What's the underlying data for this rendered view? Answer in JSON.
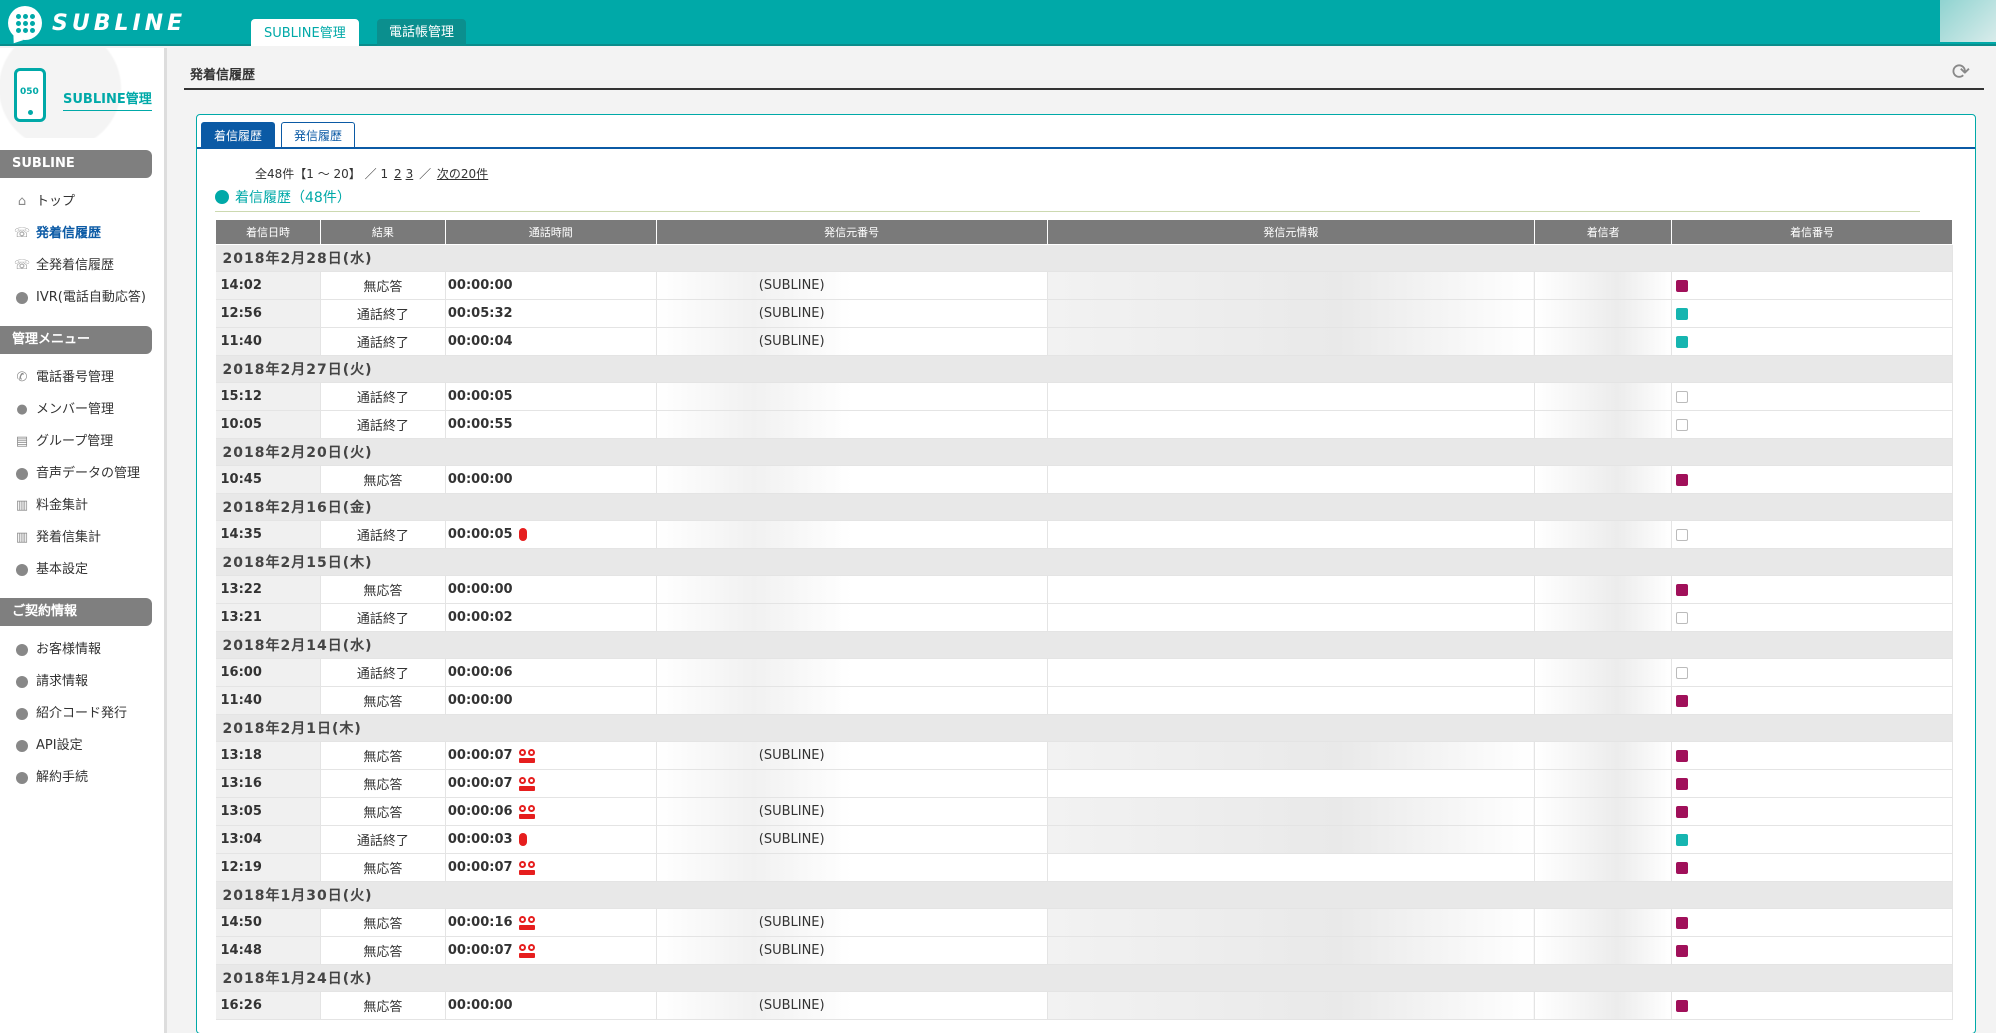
{
  "app": {
    "brand": "SUBLINE",
    "top_tabs": [
      "SUBLINE管理",
      "電話帳管理"
    ]
  },
  "sidebar": {
    "phone_label": "050",
    "title": "SUBLINE管理",
    "sections": [
      {
        "title": "SUBLINE",
        "items": [
          {
            "label": "トップ",
            "icon": "home-icon"
          },
          {
            "label": "発着信履歴",
            "icon": "phone-call-icon",
            "active": true
          },
          {
            "label": "全発着信履歴",
            "icon": "phone-call-icon"
          },
          {
            "label": "IVR(電話自動応答)",
            "icon": "bubble-icon"
          }
        ]
      },
      {
        "title": "管理メニュー",
        "items": [
          {
            "label": "電話番号管理",
            "icon": "phone-icon"
          },
          {
            "label": "メンバー管理",
            "icon": "user-icon"
          },
          {
            "label": "グループ管理",
            "icon": "building-icon"
          },
          {
            "label": "音声データの管理",
            "icon": "bubble-icon"
          },
          {
            "label": "料金集計",
            "icon": "bar-chart-icon"
          },
          {
            "label": "発着信集計",
            "icon": "bar-chart-icon"
          },
          {
            "label": "基本設定",
            "icon": "bubble-icon"
          }
        ]
      },
      {
        "title": "ご契約情報",
        "items": [
          {
            "label": "お客様情報",
            "icon": "bubble-icon"
          },
          {
            "label": "請求情報",
            "icon": "bubble-icon"
          },
          {
            "label": "紹介コード発行",
            "icon": "bubble-icon"
          },
          {
            "label": "API設定",
            "icon": "bubble-icon"
          },
          {
            "label": "解約手続",
            "icon": "bubble-icon"
          }
        ]
      }
    ]
  },
  "page": {
    "title": "発着信履歴",
    "tabs": [
      "着信履歴",
      "発信履歴"
    ],
    "pager": {
      "summary": "全48件【1 ～ 20】",
      "sep": "／",
      "current": "1",
      "pages": [
        "2",
        "3"
      ],
      "next": "次の20件"
    },
    "list_title": "着信履歴（48件）",
    "columns": [
      "着信日時",
      "結果",
      "通話時間",
      "発信元番号",
      "発信元情報",
      "着信者",
      "着信番号"
    ]
  },
  "groups": [
    {
      "date": "2018年2月28日(水)",
      "rows": [
        {
          "time": "14:02",
          "result": "無応答",
          "duration": "00:00:00",
          "icon": "",
          "source": "(SUBLINE)",
          "mark": "m"
        },
        {
          "time": "12:56",
          "result": "通話終了",
          "duration": "00:05:32",
          "icon": "",
          "source": "(SUBLINE)",
          "mark": "t"
        },
        {
          "time": "11:40",
          "result": "通話終了",
          "duration": "00:00:04",
          "icon": "",
          "source": "(SUBLINE)",
          "mark": "t"
        }
      ]
    },
    {
      "date": "2018年2月27日(火)",
      "rows": [
        {
          "time": "15:12",
          "result": "通話終了",
          "duration": "00:00:05",
          "icon": "",
          "source": "",
          "mark": "e"
        },
        {
          "time": "10:05",
          "result": "通話終了",
          "duration": "00:00:55",
          "icon": "",
          "source": "",
          "mark": "e"
        }
      ]
    },
    {
      "date": "2018年2月20日(火)",
      "rows": [
        {
          "time": "10:45",
          "result": "無応答",
          "duration": "00:00:00",
          "icon": "",
          "source": "",
          "mark": "m"
        }
      ]
    },
    {
      "date": "2018年2月16日(金)",
      "rows": [
        {
          "time": "14:35",
          "result": "通話終了",
          "duration": "00:00:05",
          "icon": "mic",
          "source": "",
          "mark": "e"
        }
      ]
    },
    {
      "date": "2018年2月15日(木)",
      "rows": [
        {
          "time": "13:22",
          "result": "無応答",
          "duration": "00:00:00",
          "icon": "",
          "source": "",
          "mark": "m"
        },
        {
          "time": "13:21",
          "result": "通話終了",
          "duration": "00:00:02",
          "icon": "",
          "source": "",
          "mark": "e"
        }
      ]
    },
    {
      "date": "2018年2月14日(水)",
      "rows": [
        {
          "time": "16:00",
          "result": "通話終了",
          "duration": "00:00:06",
          "icon": "",
          "source": "",
          "mark": "e"
        },
        {
          "time": "11:40",
          "result": "無応答",
          "duration": "00:00:00",
          "icon": "",
          "source": "",
          "mark": "m"
        }
      ]
    },
    {
      "date": "2018年2月1日(木)",
      "rows": [
        {
          "time": "13:18",
          "result": "無応答",
          "duration": "00:00:07",
          "icon": "vm",
          "source": "(SUBLINE)",
          "mark": "m"
        },
        {
          "time": "13:16",
          "result": "無応答",
          "duration": "00:00:07",
          "icon": "vm",
          "source": "",
          "mark": "m"
        },
        {
          "time": "13:05",
          "result": "無応答",
          "duration": "00:00:06",
          "icon": "vm",
          "source": "(SUBLINE)",
          "mark": "m"
        },
        {
          "time": "13:04",
          "result": "通話終了",
          "duration": "00:00:03",
          "icon": "mic",
          "source": "(SUBLINE)",
          "mark": "t"
        },
        {
          "time": "12:19",
          "result": "無応答",
          "duration": "00:00:07",
          "icon": "vm",
          "source": "",
          "mark": "m"
        }
      ]
    },
    {
      "date": "2018年1月30日(火)",
      "rows": [
        {
          "time": "14:50",
          "result": "無応答",
          "duration": "00:00:16",
          "icon": "vm",
          "source": "(SUBLINE)",
          "mark": "m"
        },
        {
          "time": "14:48",
          "result": "無応答",
          "duration": "00:00:07",
          "icon": "vm",
          "source": "(SUBLINE)",
          "mark": "m"
        }
      ]
    },
    {
      "date": "2018年1月24日(水)",
      "rows": [
        {
          "time": "16:26",
          "result": "無応答",
          "duration": "00:00:00",
          "icon": "",
          "source": "(SUBLINE)",
          "mark": "m"
        }
      ]
    }
  ],
  "colors": {
    "brand": "#00a9a8",
    "navy": "#0b5aa5",
    "magenta": "#a0105a",
    "teal": "#16b5b0",
    "red": "#e61e1e"
  }
}
